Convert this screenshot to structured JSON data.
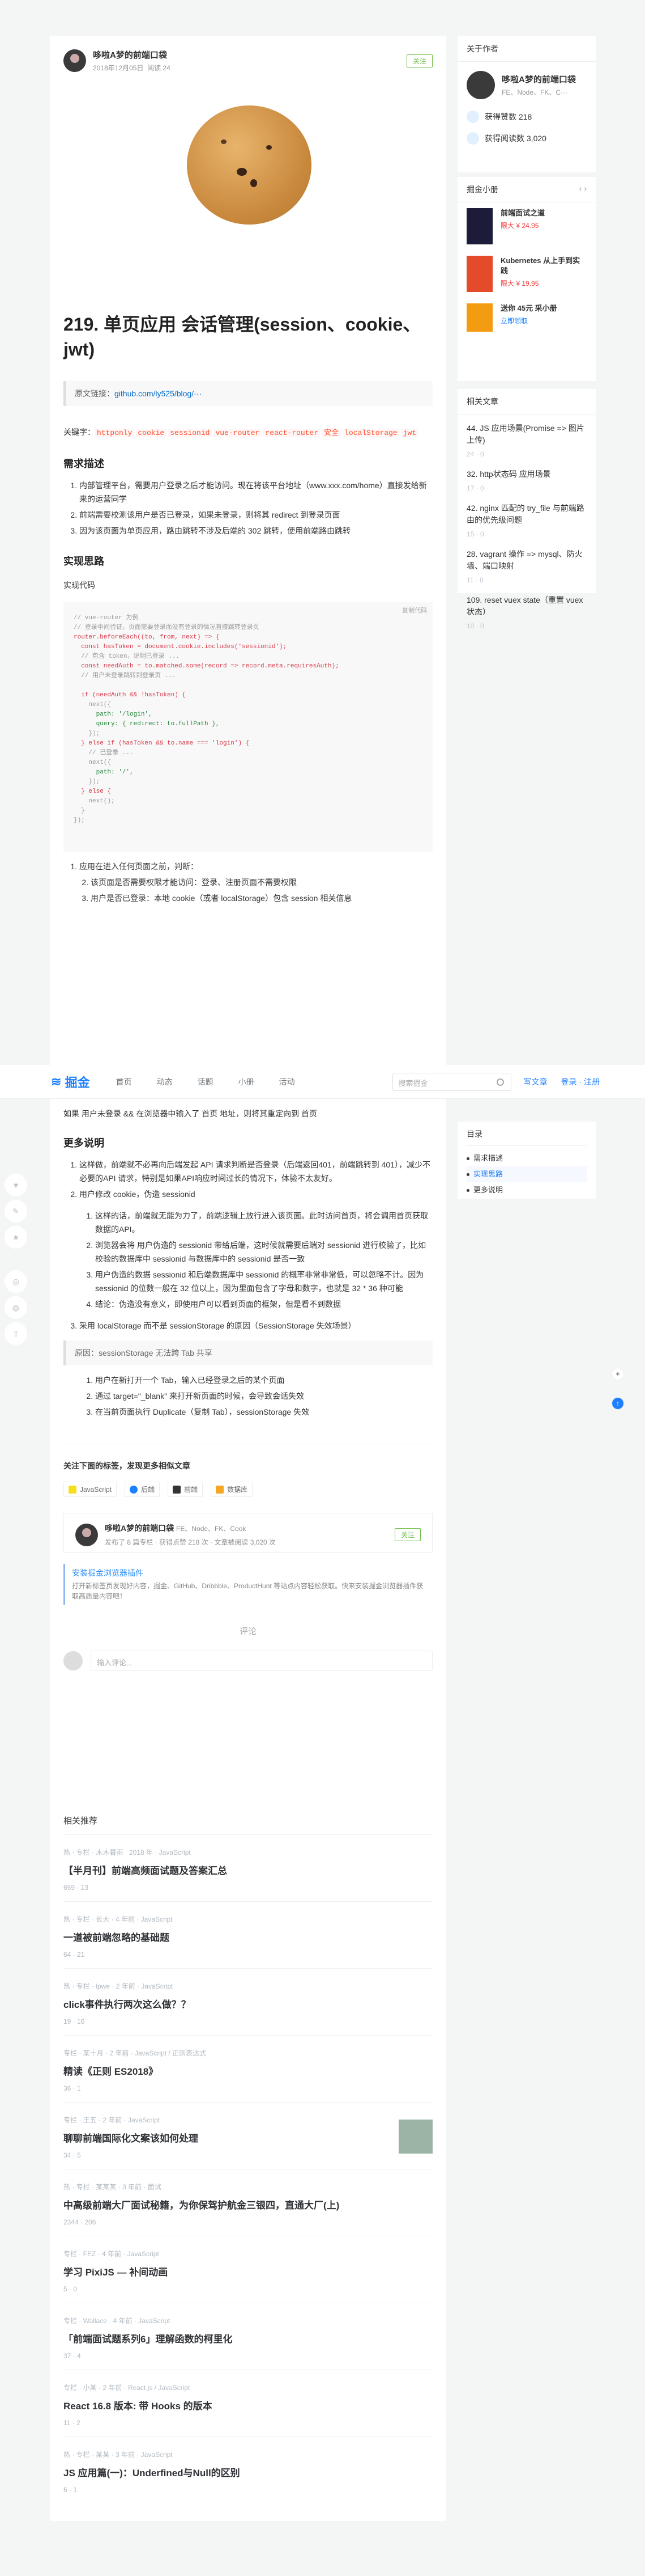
{
  "article": {
    "author": "哆啦A梦的前端口袋",
    "date": "2018年12月05日",
    "reads": "阅读 24",
    "follow": "关注",
    "title": "219. 单页应用 会话管理(session、cookie、jwt)",
    "source_label": "原文链接：",
    "source_url": "github.com/ly525/blog/···",
    "kw_label": "关键字：",
    "keywords": [
      "httponly",
      "cookie",
      "sessionid",
      "vue-router",
      "react-router",
      "安全",
      "localStorage",
      "jwt"
    ],
    "h_need": "需求描述",
    "need": [
      "内部管理平台，需要用户登录之后才能访问。现在将该平台地址（www.xxx.com/home）直接发给新来的运营同学",
      "前端需要校测该用户是否已登录，如果未登录，则将其 redirect 到登录页面",
      "因为该页面为单页应用，路由跳转不涉及后端的 302 跳转，使用前端路由跳转"
    ],
    "h_impl": "实现思路",
    "impl_sub": "实现代码",
    "copy": "复制代码",
    "code": [
      "// vue-router 为例",
      "// 登录中间验证，页面需要登录而没有登录的情况直接跳转登录页",
      "router.beforeEach((to, from, next) => {",
      "  const hasToken = document.cookie.includes('sessionid');",
      "  // 包含 token，说明已登录 ...",
      "  const needAuth = to.matched.some(record => record.meta.requiresAuth);",
      "  // 用户未登录跳转到登录页 ...",
      "",
      "  if (needAuth && !hasToken) {",
      "    next({",
      "      path: '/login',",
      "      query: { redirect: to.fullPath },",
      "    });",
      "  } else if (hasToken && to.name === 'login') {",
      "    // 已登录 ...",
      "    next({",
      "      path: '/',",
      "    });",
      "  } else {",
      "    next();",
      "  }",
      "});"
    ],
    "steps": [
      "应用在进入任何页面之前，判断：",
      "该页面是否需要权限才能访问：登录、注册页面不需要权限",
      "用户是否已登录：本地 cookie（或者 localStorage）包含 session 相关信息"
    ]
  },
  "header": {
    "logo": "掘金",
    "nav": [
      "首页",
      "动态",
      "话题",
      "小册",
      "活动"
    ],
    "search": "搜索掘金",
    "write": "写文章",
    "login": "登录 · 注册"
  },
  "article2": {
    "p1": "如果 用户未登录 && 在浏览器中输入了 首页 地址，则将其重定向到 首页",
    "h_more": "更多说明",
    "more": [
      "这样做，前端就不必再向后端发起 API 请求判断是否登录（后端返回401，前端跳转到 401），减少不必要的API 请求，特别是如果API响应时间过长的情况下，体验不太友好。",
      "用户修改 cookie，伪造 sessionid",
      "采用 localStorage 而不是 sessionStorage 的原因（SessionStorage 失效场景）"
    ],
    "more2": [
      "这样的话，前端就无能为力了，前端逻辑上放行进入该页面。此时访问首页，将会调用首页获取数据的API。",
      "浏览器会将 用户伪造的 sessionid 带给后端，这时候就需要后端对 sessionid 进行校验了，比如校验的数据库中 sessionid 与数据库中的 sessionid 是否一致",
      "用户伪造的数据 sessionid 和后端数据库中 sessionid 的概率非常非常低，可以忽略不计。因为 sessionid 的位数一般在 32 位以上，因为里面包含了字母和数字，也就是 32 * 36 种可能",
      "结论：伪造没有意义，即使用户可以看到页面的框架，但是看不到数据"
    ],
    "note": "原因：sessionStorage 无法跨 Tab 共享",
    "more3": [
      "用户在新打开一个 Tab，输入已经登录之后的某个页面",
      "通过 target=\"_blank\" 来打开新页面的时候，会导致会话失效",
      "在当前页面执行 Duplicate（复制 Tab），sessionStorage 失效"
    ],
    "tags_title": "关注下面的标签，发现更多相似文章",
    "tags": [
      "JavaScript",
      "后端",
      "前端",
      "数据库"
    ],
    "author": "哆啦A梦的前端口袋",
    "author_tags": "FE、Node、FK、Cook",
    "author_stats": "发布了 8 篇专栏 · 获得点赞 218 次 · 文章被阅读 3,020 次",
    "follow": "关注",
    "promo_t": "安装掘金浏览器插件",
    "promo_d": "打开新标签页发现好内容，掘金、GitHub、Dribbble、ProductHunt 等站点内容轻松获取。快来安装掘金浏览器插件获取高质量内容吧！",
    "comments": "评论",
    "comment_ph": "输入评论..."
  },
  "sidebar": {
    "title": "关于作者",
    "name": "哆啦A梦的前端口袋",
    "sub": "FE、Node、FK、C···",
    "likes": "获得赞数 218",
    "reads": "获得阅读数 3,020",
    "books_title": "掘金小册",
    "books": [
      {
        "t": "前端面试之道",
        "p": "限大 ¥ 24.95"
      },
      {
        "t": "Kubernetes 从上手到实践",
        "p": "限大 ¥ 19.95"
      },
      {
        "t": "送你 45元 采小册",
        "p": "立即领取"
      }
    ],
    "rel_title": "相关文章",
    "rel": [
      {
        "t": "44. JS 应用场景(Promise => 图片上传)",
        "s": "24  ·  0"
      },
      {
        "t": "32. http状态码 应用场景",
        "s": "17  ·  0"
      },
      {
        "t": "42. nginx 匹配的 try_file 与前端路由的优先级问题",
        "s": "15  ·  0"
      },
      {
        "t": "28. vagrant 操作 => mysql、防火墙、端口映射",
        "s": "11  ·  0"
      },
      {
        "t": "109. reset vuex state（重置 vuex 状态）",
        "s": "10  ·  0"
      }
    ],
    "toc_title": "目录",
    "toc": [
      "需求描述",
      "实现思路",
      "更多说明"
    ]
  },
  "rec": {
    "title": "相关推荐",
    "items": [
      {
        "m": "热 · 专栏 · 木木暮雨 · 2018 年 · JavaScript",
        "t": "【半月刊】前端高频面试题及答案汇总",
        "s": "659  ·  13"
      },
      {
        "m": "热 · 专栏 · 长大 · 4 年前 · JavaScript",
        "t": "一道被前端忽略的基础题",
        "s": "64  ·  21"
      },
      {
        "m": "热 · 专栏 · lpwe · 2 年前 · JavaScript",
        "t": "click事件执行两次这么做？？",
        "s": "19  ·  16"
      },
      {
        "m": "专栏 · 某十月 · 2 年前 · JavaScript / 正则表达式",
        "t": "精读《正则 ES2018》",
        "s": "36  ·  1"
      },
      {
        "m": "专栏 · 王五 · 2 年前 · JavaScript",
        "t": "聊聊前端国际化文案该如何处理",
        "s": "34  ·  5"
      },
      {
        "m": "热 · 专栏 · 某某某 · 3 年前 · 面试",
        "t": "中高级前端大厂面试秘籍，为你保驾护航金三银四，直通大厂(上)",
        "s": "2344  ·  206"
      },
      {
        "m": "专栏 · FEZ · 4 年前 · JavaScript",
        "t": "学习 PixiJS — 补间动画",
        "s": "5  ·  0"
      },
      {
        "m": "专栏 · Wallace · 4 年前 · JavaScript",
        "t": "「前端面试题系列6」理解函数的柯里化",
        "s": "37  ·  4"
      },
      {
        "m": "专栏 · 小某 · 2 年前 · React.js / JavaScript",
        "t": "React 16.8 版本: 带 Hooks 的版本",
        "s": "11  ·  2"
      },
      {
        "m": "热 · 专栏 · 某某 · 3 年前 · JavaScript",
        "t": "JS 应用篇(一)：Underfined与Null的区别",
        "s": "6  ·  1"
      }
    ]
  },
  "side_icons": [
    "like-icon",
    "comment-icon",
    "collect-icon",
    "share-icon",
    "weibo-icon",
    "wechat-icon",
    "more-icon"
  ]
}
